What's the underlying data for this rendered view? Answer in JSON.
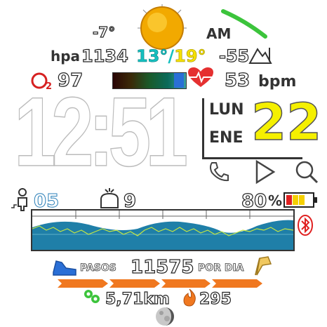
{
  "weather": {
    "temp_current": "-7°",
    "pressure_label": "hpa",
    "pressure_value": "1134",
    "temp_min": "13°",
    "temp_sep": "/",
    "temp_max": "19°",
    "icon": "sun-icon"
  },
  "time": {
    "ampm": "AM",
    "digits": "12:51",
    "value": "-55"
  },
  "health": {
    "o2_label": "O",
    "o2_sub": "2",
    "o2_value": "97",
    "heart_rate": "53",
    "heart_unit": "bpm"
  },
  "date": {
    "weekday": "LUN",
    "month": "ENE",
    "day": "22"
  },
  "stats": {
    "floors": "05",
    "stress": "9",
    "battery_percent": "80",
    "percent_sign": "%",
    "battery_level": 0.8
  },
  "steps": {
    "label": "PASOS",
    "value": "11575",
    "per_day_label": "POR DIA"
  },
  "activity": {
    "distance": "5,71km",
    "calories": "295"
  },
  "colors": {
    "sun": "#f2a900",
    "green_arc": "#3cc43c",
    "yellow": "#f5f000",
    "heart": "#e53030",
    "orange": "#f07820",
    "blue": "#2a6fd6",
    "graph_fill": "#1f7fa8"
  }
}
